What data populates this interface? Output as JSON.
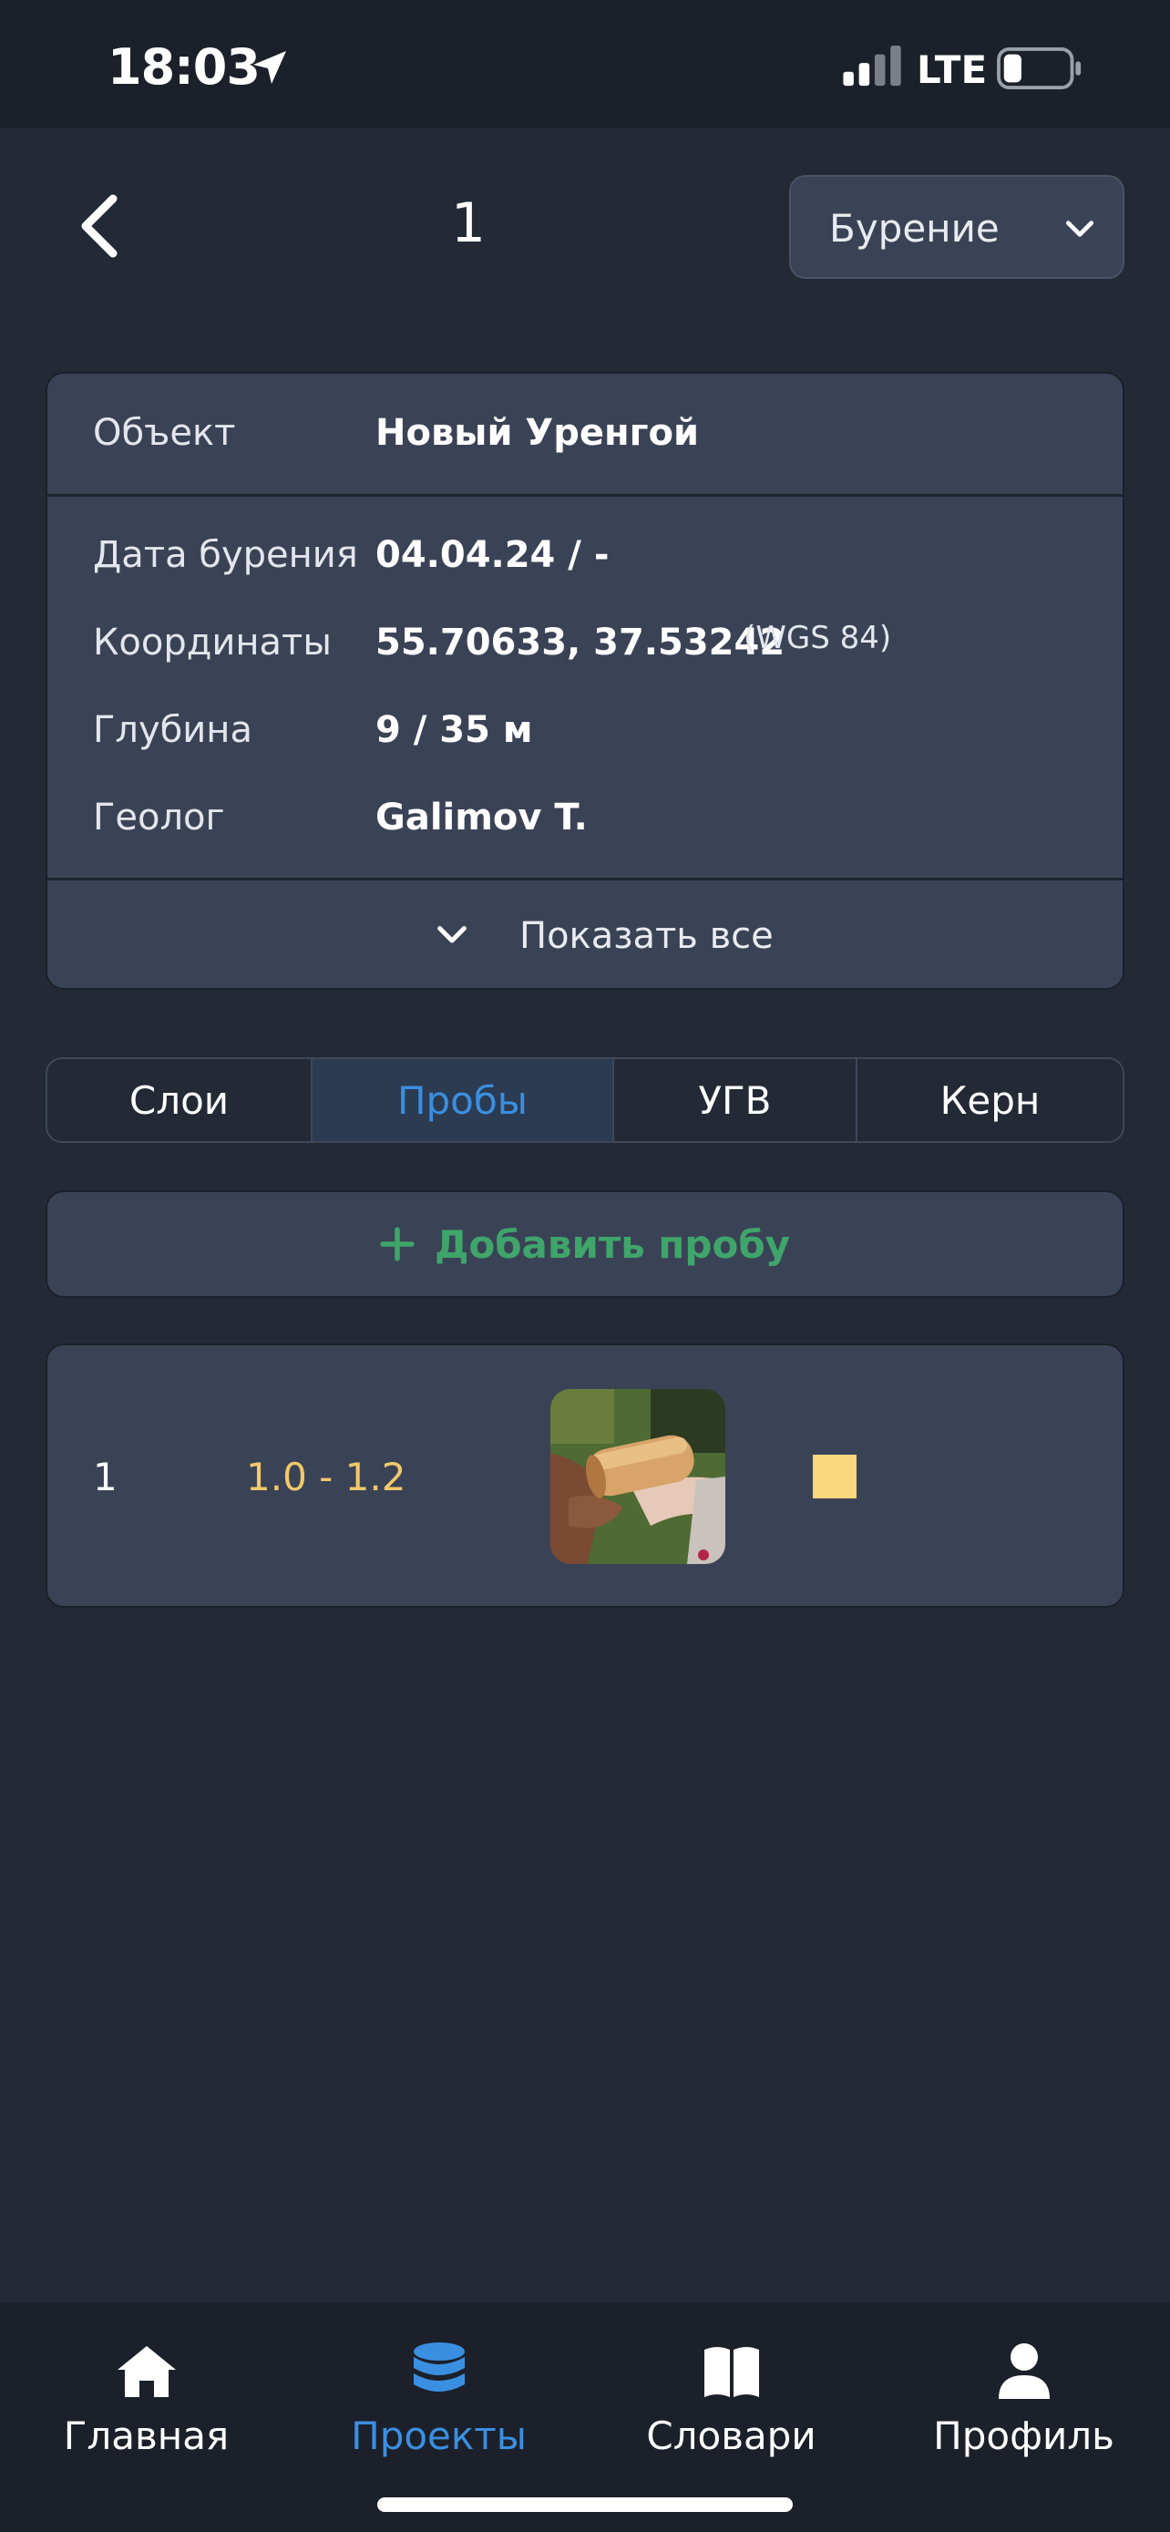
{
  "status_bar": {
    "time": "18:03",
    "network": "LTE"
  },
  "header": {
    "title": "1",
    "mode_select": {
      "selected": "Бурение"
    }
  },
  "info": {
    "object": {
      "label": "Объект",
      "value": "Новый Уренгой"
    },
    "rows": [
      {
        "label": "Дата бурения",
        "value": "04.04.24 / -"
      },
      {
        "label": "Координаты",
        "value": "55.70633, 37.53242",
        "note": "(WGS 84)"
      },
      {
        "label": "Глубина",
        "value": "9 / 35 м"
      },
      {
        "label": "Геолог",
        "value": "Galimov T."
      }
    ],
    "show_all_label": "Показать все"
  },
  "tabs": [
    {
      "label": "Слои",
      "active": false
    },
    {
      "label": "Пробы",
      "active": true
    },
    {
      "label": "УГВ",
      "active": false
    },
    {
      "label": "Керн",
      "active": false
    }
  ],
  "add_sample_label": "Добавить пробу",
  "samples": [
    {
      "number": "1",
      "depth": "1.0 - 1.2",
      "photo_icon": "sample-photo",
      "color": "#fad67e"
    }
  ],
  "bottom_nav": [
    {
      "label": "Главная",
      "icon": "home-icon",
      "active": false
    },
    {
      "label": "Проекты",
      "icon": "database-icon",
      "active": true
    },
    {
      "label": "Словари",
      "icon": "book-icon",
      "active": false
    },
    {
      "label": "Профиль",
      "icon": "user-icon",
      "active": false
    }
  ],
  "colors": {
    "accent": "#3b8fe0",
    "success": "#3fa56a",
    "depth_text": "#f2c96b",
    "card": "#3a4356",
    "background": "#232a36"
  }
}
